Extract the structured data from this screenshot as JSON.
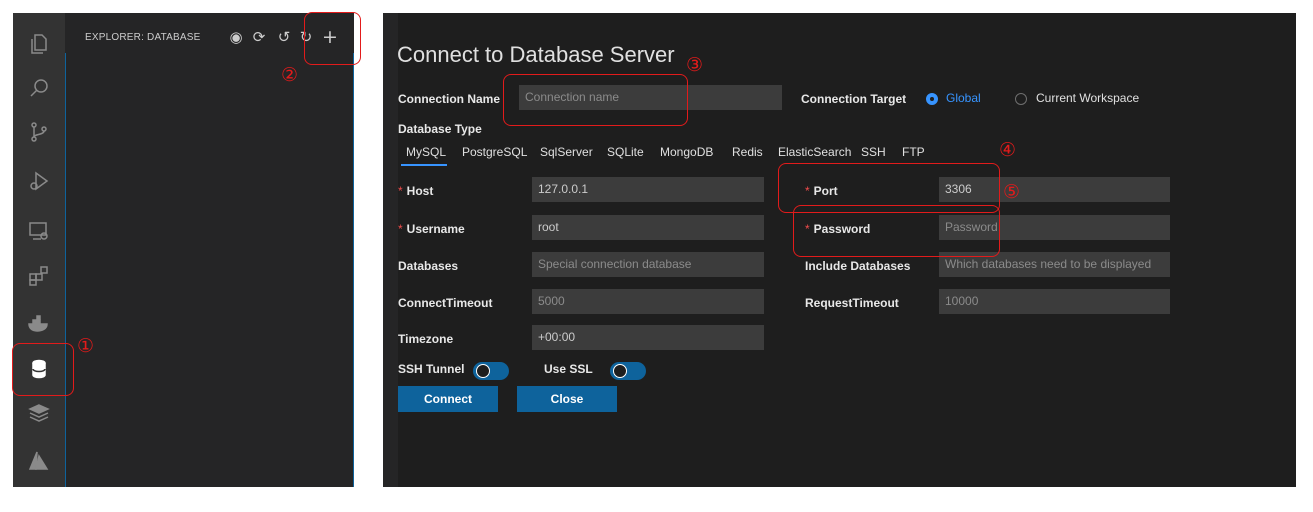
{
  "sidebar": {
    "title": "EXPLORER: DATABASE",
    "header_icons": [
      "github-icon",
      "refresh-icon",
      "history-icon",
      "reload-icon",
      "plus-icon"
    ]
  },
  "activity_bar": {
    "icons": [
      "explorer-icon",
      "search-icon",
      "source-control-icon",
      "run-debug-icon",
      "remote-explorer-icon",
      "extensions-icon",
      "docker-icon",
      "database-icon",
      "layers-icon",
      "azure-icon"
    ],
    "active": "database-icon"
  },
  "form": {
    "title": "Connect to Database Server",
    "connection_name_label": "Connection Name",
    "connection_name_placeholder": "Connection name",
    "connection_target_label": "Connection Target",
    "target_global": "Global",
    "target_workspace": "Current Workspace",
    "database_type_label": "Database Type",
    "db_types": [
      "MySQL",
      "PostgreSQL",
      "SqlServer",
      "SQLite",
      "MongoDB",
      "Redis",
      "ElasticSearch",
      "SSH",
      "FTP"
    ],
    "selected_db_type": "MySQL",
    "required_mark": "*",
    "host_label": "Host",
    "host_value": "127.0.0.1",
    "port_label": "Port",
    "port_value": "3306",
    "username_label": "Username",
    "username_value": "root",
    "password_label": "Password",
    "password_placeholder": "Password",
    "databases_label": "Databases",
    "databases_placeholder": "Special connection database",
    "include_databases_label": "Include Databases",
    "include_databases_placeholder": "Which databases need to be displayed",
    "connect_timeout_label": "ConnectTimeout",
    "connect_timeout_placeholder": "5000",
    "request_timeout_label": "RequestTimeout",
    "request_timeout_placeholder": "10000",
    "timezone_label": "Timezone",
    "timezone_value": "+00:00",
    "ssh_tunnel_label": "SSH Tunnel",
    "use_ssl_label": "Use SSL",
    "connect_button": "Connect",
    "close_button": "Close"
  },
  "annotations": {
    "n1": "①",
    "n2": "②",
    "n3": "③",
    "n4": "④",
    "n5": "⑤"
  },
  "colors": {
    "accent": "#0e639c",
    "link": "#3794ff",
    "annotation": "#e21b1b",
    "required": "#f14c4c"
  }
}
